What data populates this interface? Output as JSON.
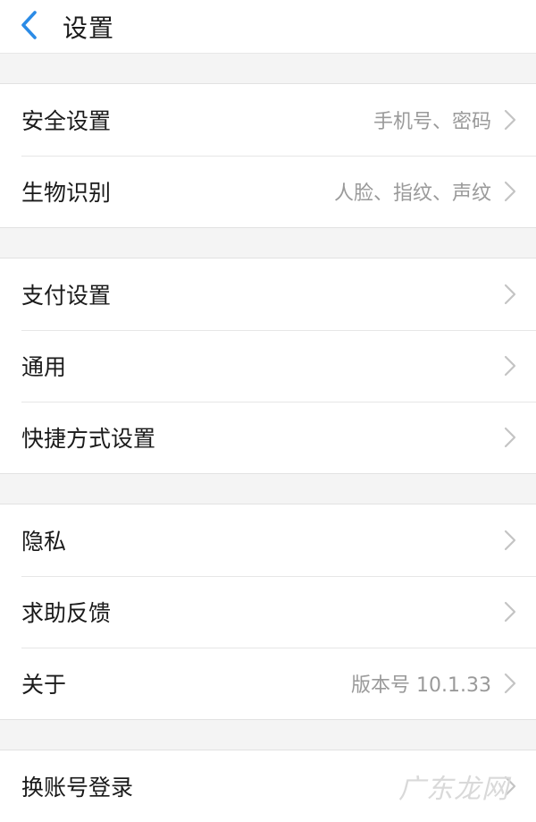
{
  "header": {
    "title": "设置",
    "back_icon": "chevron-left-icon",
    "accent_color": "#2b8be6"
  },
  "groups": [
    {
      "items": [
        {
          "label": "安全设置",
          "value": "手机号、密码"
        },
        {
          "label": "生物识别",
          "value": "人脸、指纹、声纹"
        }
      ]
    },
    {
      "items": [
        {
          "label": "支付设置",
          "value": ""
        },
        {
          "label": "通用",
          "value": ""
        },
        {
          "label": "快捷方式设置",
          "value": ""
        }
      ]
    },
    {
      "items": [
        {
          "label": "隐私",
          "value": ""
        },
        {
          "label": "求助反馈",
          "value": ""
        },
        {
          "label": "关于",
          "value": "版本号 10.1.33"
        }
      ]
    },
    {
      "items": [
        {
          "label": "换账号登录",
          "value": ""
        }
      ]
    }
  ],
  "watermark": "广东龙网"
}
